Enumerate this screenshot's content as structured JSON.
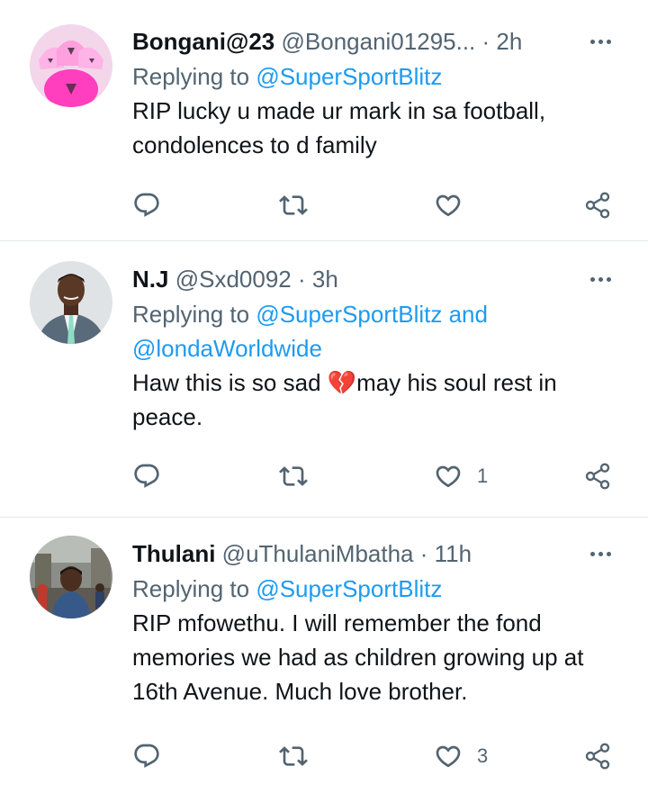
{
  "tweets": [
    {
      "name": "Bongani@23",
      "handle": "@Bongani01295...",
      "dot": " · ",
      "time": "2h",
      "reply_prefix": "Replying to ",
      "reply_to": "@SuperSportBlitz",
      "text": "RIP lucky u made ur mark in sa football, condolences to d family",
      "likes": ""
    },
    {
      "name": "N.J",
      "handle": "@Sxd0092",
      "dot": " · ",
      "time": "3h",
      "reply_prefix": "Replying to ",
      "reply_to": "@SuperSportBlitz and @londaWorldwide",
      "text_before": "Haw this is so sad ",
      "emoji": "💔",
      "text_after": "may his soul rest in peace.",
      "likes": "1"
    },
    {
      "name": "Thulani",
      "handle": "@uThulaniMbatha",
      "dot": " · ",
      "time": "11h",
      "reply_prefix": "Replying to ",
      "reply_to": "@SuperSportBlitz",
      "text": "RIP mfowethu. I will remember the fond memories we had as children growing up at 16th Avenue. Much love brother.",
      "likes": "3"
    }
  ],
  "icons": {
    "reply": "reply-icon",
    "retweet": "retweet-icon",
    "like": "heart-icon",
    "share": "share-icon",
    "more": "more-icon"
  },
  "colors": {
    "text": "#0f1419",
    "secondary": "#536471",
    "link": "#1d9bf0",
    "divider": "#e1e8ed"
  }
}
